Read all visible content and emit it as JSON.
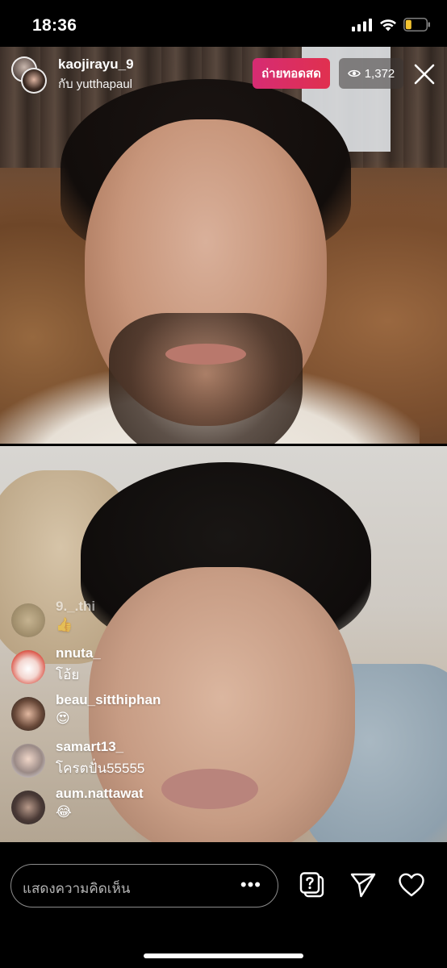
{
  "status_bar": {
    "time": "18:36",
    "battery_level": 0.25,
    "battery_color": "#f4c430"
  },
  "header": {
    "host_username": "kaojirayu_9",
    "with_label": "กับ yutthapaul",
    "live_label": "ถ่ายทอดสด",
    "viewer_count": "1,372",
    "live_badge_color": "#d62c73"
  },
  "comments": [
    {
      "username": "9._.thi",
      "text": "👍",
      "faded": true
    },
    {
      "username": "nnuta_",
      "text": "โอ้ย"
    },
    {
      "username": "beau_sitthiphan",
      "text": "😍"
    },
    {
      "username": "samart13_",
      "text": "โครตปั่น55555"
    },
    {
      "username": "aum.nattawat",
      "text": "😂"
    }
  ],
  "bottom_bar": {
    "comment_placeholder": "แสดงความคิดเห็น",
    "more_label": "•••"
  }
}
